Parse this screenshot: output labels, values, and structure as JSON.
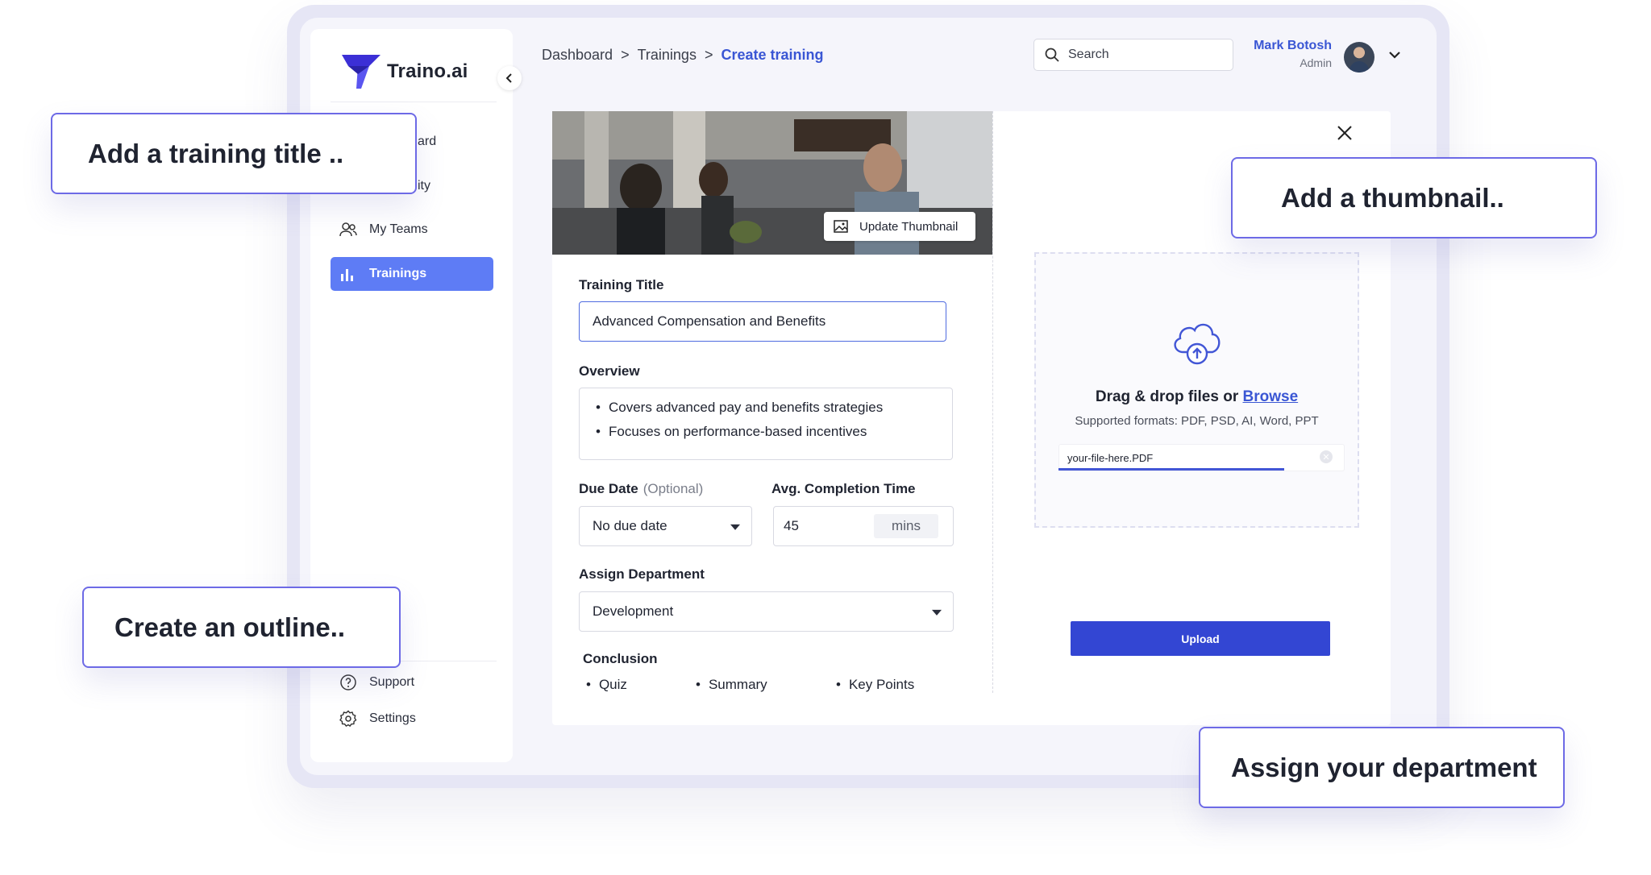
{
  "app": {
    "name": "Traino.ai",
    "brand_color": "#3a56d4"
  },
  "sidebar": {
    "items": [
      {
        "label": "My Teams",
        "icon": "users-icon"
      },
      {
        "label": "Trainings",
        "icon": "bar-chart-icon",
        "active": true
      }
    ],
    "partial": [
      {
        "label": "ard"
      },
      {
        "label": "ity"
      }
    ],
    "footer": [
      {
        "label": "Support",
        "icon": "help-circle-icon"
      },
      {
        "label": "Settings",
        "icon": "gear-icon"
      }
    ]
  },
  "breadcrumb": {
    "items": [
      "Dashboard",
      "Trainings"
    ],
    "current": "Create training",
    "separator": ">"
  },
  "search": {
    "placeholder": "Search"
  },
  "user": {
    "name": "Mark Botosh",
    "role": "Admin"
  },
  "form": {
    "update_thumbnail": "Update Thumbnail",
    "title_label": "Training Title",
    "title_value": "Advanced Compensation and Benefits",
    "overview_label": "Overview",
    "overview_items": [
      "Covers advanced pay and benefits strategies",
      "Focuses on performance-based incentives"
    ],
    "due_date_label": "Due Date",
    "due_date_optional": "(Optional)",
    "due_date_value": "No due date",
    "completion_label": "Avg. Completion Time",
    "completion_value": "45",
    "completion_unit": "mins",
    "department_label": "Assign Department",
    "department_value": "Development",
    "conclusion_label": "Conclusion",
    "conclusion_items": [
      "Quiz",
      "Summary",
      "Key Points"
    ]
  },
  "upload": {
    "title_prefix": "Drag & drop files or",
    "browse": "Browse",
    "formats": "Supported formats: PDF, PSD, AI, Word, PPT",
    "file_name": "your-file-here.PDF",
    "progress": 0.79,
    "button": "Upload"
  },
  "callouts": {
    "title": "Add a training title  ..",
    "thumbnail": "Add a thumbnail..",
    "outline": "Create an outline..",
    "department": "Assign your department"
  },
  "colors": {
    "accent": "#6d6ae6",
    "active_nav": "#5e7cf5",
    "upload_button": "#3346d3"
  }
}
